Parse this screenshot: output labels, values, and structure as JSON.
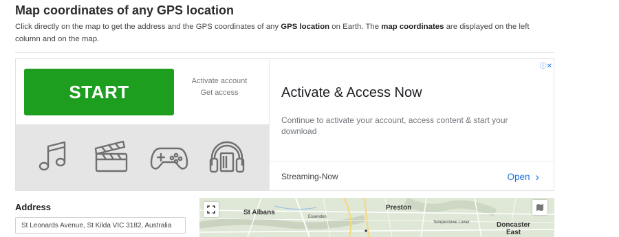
{
  "page": {
    "title": "Map coordinates of any GPS location",
    "intro": {
      "part1": "Click directly on the map to get the address and the GPS coordinates of any ",
      "bold1": "GPS location",
      "part2": " on Earth. The ",
      "bold2": "map coordinates",
      "part3": " are displayed on the left column and on the map."
    }
  },
  "ad": {
    "start_label": "START",
    "side_line1": "Activate account",
    "side_line2": "Get access",
    "icons": [
      "music-note-icon",
      "clapperboard-icon",
      "gamepad-icon",
      "headphones-icon"
    ],
    "headline": "Activate & Access Now",
    "description": "Continue to activate your account, access content & start your download",
    "source": "Streaming-Now",
    "open_label": "Open",
    "open_chevron": "›",
    "adchoices_glyph": "ⓘ✕",
    "colors": {
      "start_green": "#1e9e1e",
      "open_blue": "#1a73e8",
      "icon_panel": "#e5e5e5"
    }
  },
  "address": {
    "label": "Address",
    "value": "St Leonards Avenue, St Kilda VIC 3182, Australia"
  },
  "map": {
    "labels": {
      "st_albans": "St Albans",
      "essendon": "Essendon",
      "preston": "Preston",
      "templestowe": "Templestowe Lower",
      "doncaster": "Doncaster",
      "east": "East"
    },
    "icons": [
      "fullscreen-icon",
      "map-layers-icon"
    ]
  }
}
